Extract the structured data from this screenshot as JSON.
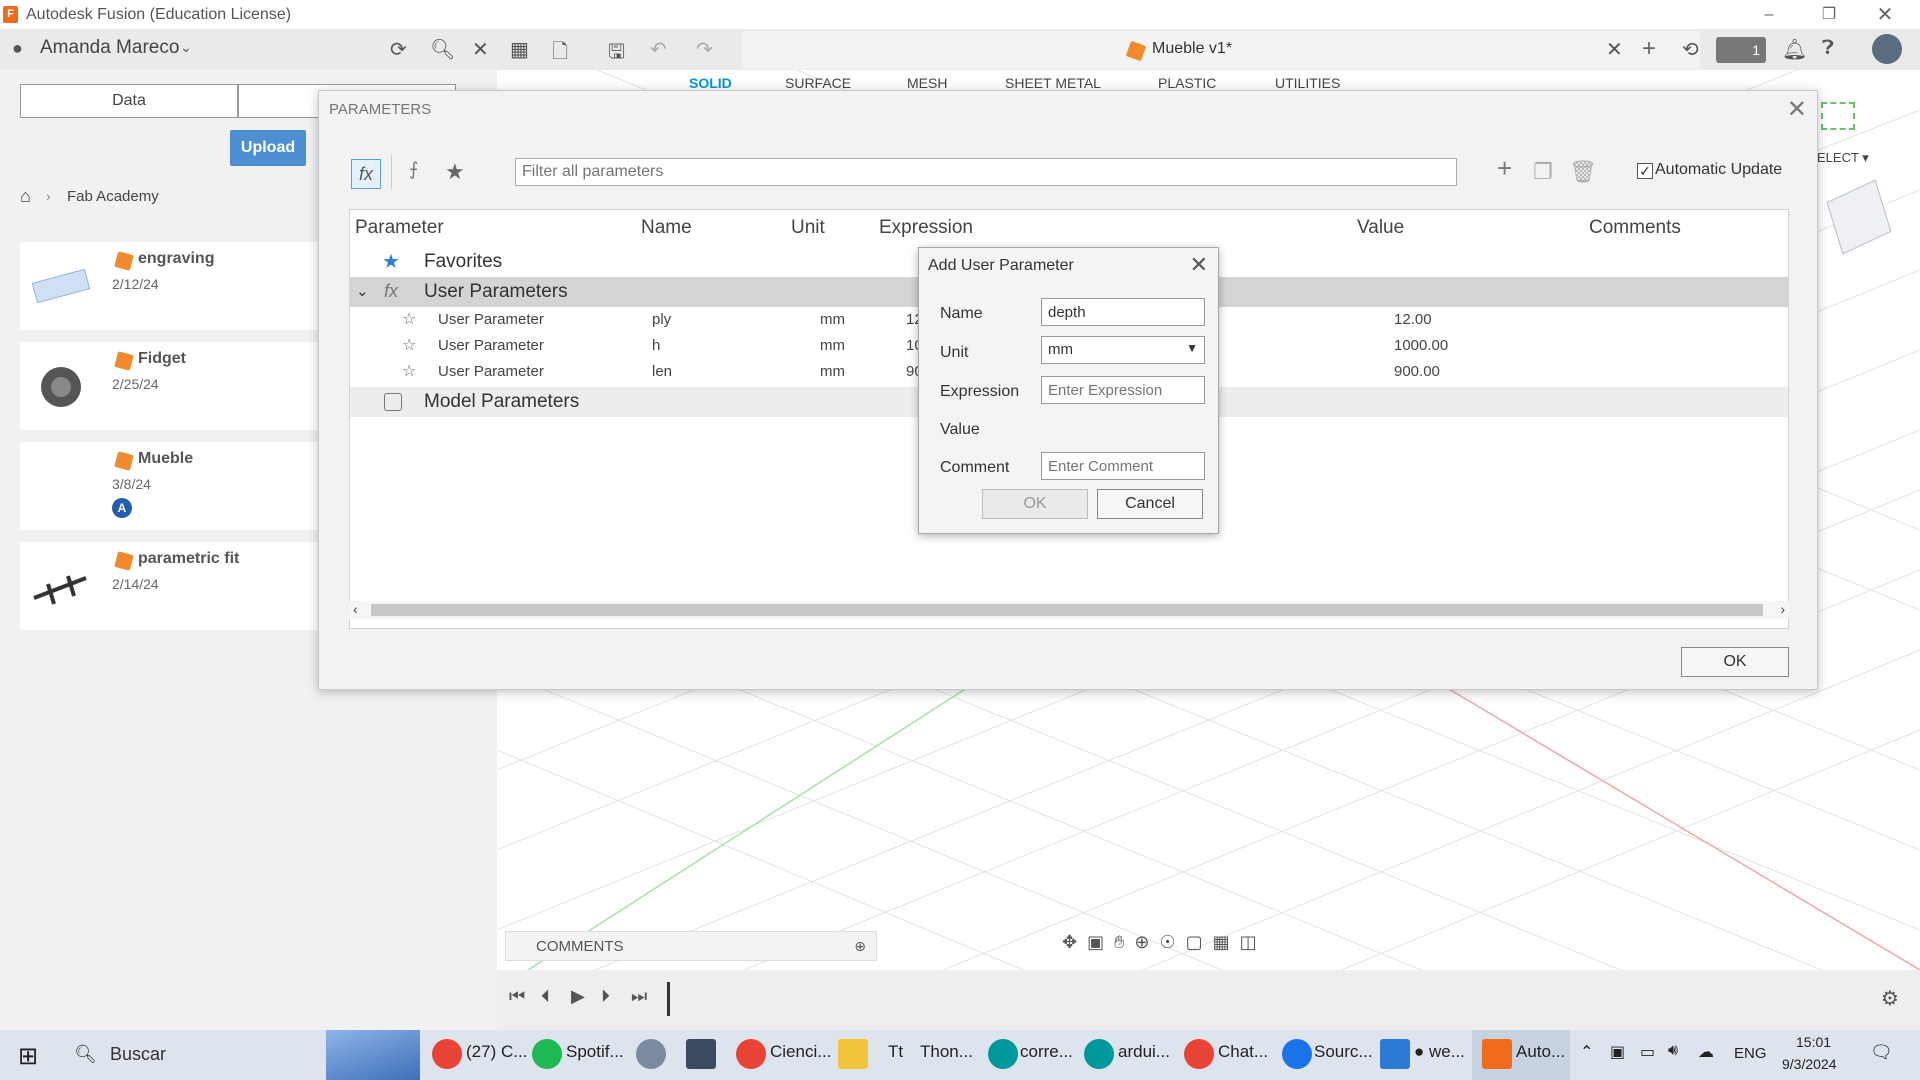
{
  "window": {
    "title": "Autodesk Fusion (Education License)",
    "app_icon_letter": "F"
  },
  "toolbar": {
    "user_name": "Amanda Mareco",
    "document_title": "Mueble v1*",
    "badge_count": "1"
  },
  "workspace_tabs": [
    "SOLID",
    "SURFACE",
    "MESH",
    "SHEET METAL",
    "PLASTIC",
    "UTILITIES"
  ],
  "select_label": "ELECT ▾",
  "data_panel": {
    "tab_data": "Data",
    "upload_label": "Upload",
    "breadcrumb": "Fab Academy",
    "items": [
      {
        "name": "engraving",
        "date": "2/12/24"
      },
      {
        "name": "Fidget",
        "date": "2/25/24"
      },
      {
        "name": "Mueble",
        "date": "3/8/24",
        "badge": "A"
      },
      {
        "name": "parametric fit",
        "date": "2/14/24"
      }
    ]
  },
  "parameters_dialog": {
    "title": "PARAMETERS",
    "filter_placeholder": "Filter all parameters",
    "automatic_update_label": "Automatic Update",
    "columns": [
      "Parameter",
      "Name",
      "Unit",
      "Expression",
      "Value",
      "Comments"
    ],
    "groups": {
      "favorites": "Favorites",
      "user": "User Parameters",
      "model": "Model Parameters"
    },
    "rows": [
      {
        "parameter": "User Parameter",
        "name": "ply",
        "unit": "mm",
        "expression": "12 mm",
        "value": "12.00"
      },
      {
        "parameter": "User Parameter",
        "name": "h",
        "unit": "mm",
        "expression": "1000",
        "value": "1000.00"
      },
      {
        "parameter": "User Parameter",
        "name": "len",
        "unit": "mm",
        "expression": "900 m",
        "value": "900.00"
      }
    ],
    "ok_label": "OK"
  },
  "add_user_parameter": {
    "title": "Add User Parameter",
    "name_label": "Name",
    "name_value": "depth",
    "unit_label": "Unit",
    "unit_value": "mm",
    "expression_label": "Expression",
    "expression_placeholder": "Enter Expression",
    "value_label": "Value",
    "comment_label": "Comment",
    "comment_placeholder": "Enter Comment",
    "ok_label": "OK",
    "cancel_label": "Cancel"
  },
  "bottom": {
    "comments_label": "COMMENTS"
  },
  "taskbar": {
    "search_placeholder": "Buscar",
    "apps": [
      "(27) C...",
      "Spotif...",
      "Cienci...",
      "Thon...",
      "corre...",
      "ardui...",
      "Chat...",
      "Sourc...",
      "● we...",
      "Auto..."
    ],
    "language": "ENG",
    "time": "15:01",
    "date": "9/3/2024"
  },
  "colors": {
    "accent": "#0696d7",
    "upload": "#4d8fd4",
    "fusion_orange": "#f26a1b"
  }
}
